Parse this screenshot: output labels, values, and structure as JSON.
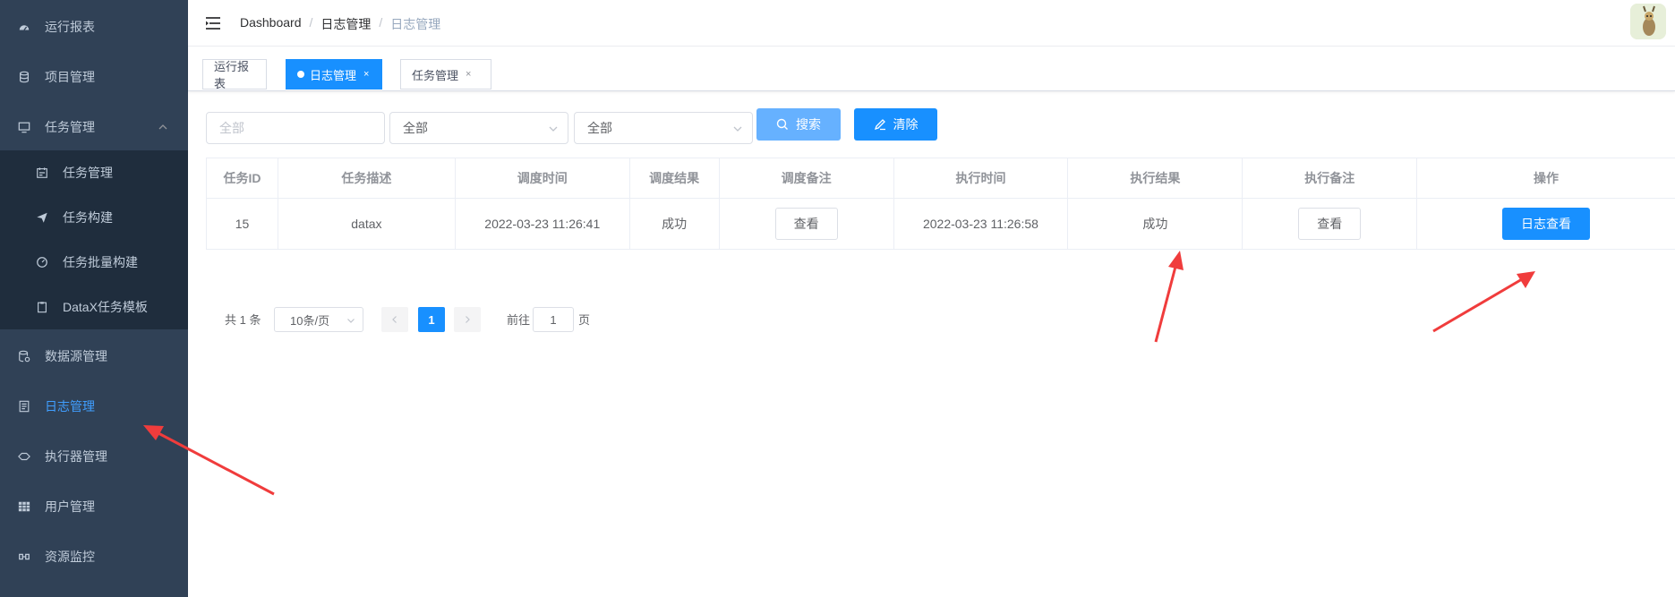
{
  "sidebar": {
    "items": [
      {
        "label": "运行报表",
        "icon": "dashboard-icon"
      },
      {
        "label": "项目管理",
        "icon": "database-icon"
      },
      {
        "label": "任务管理",
        "icon": "monitor-icon"
      },
      {
        "label": "数据源管理",
        "icon": "datasource-icon"
      },
      {
        "label": "日志管理",
        "icon": "document-icon"
      },
      {
        "label": "执行器管理",
        "icon": "executor-icon"
      },
      {
        "label": "用户管理",
        "icon": "grid-icon"
      },
      {
        "label": "资源监控",
        "icon": "infinity-icon"
      }
    ],
    "subitems": [
      {
        "label": "任务管理",
        "icon": "calendar-icon"
      },
      {
        "label": "任务构建",
        "icon": "send-icon"
      },
      {
        "label": "任务批量构建",
        "icon": "gauge-icon"
      },
      {
        "label": "DataX任务模板",
        "icon": "clipboard-icon"
      }
    ],
    "active": "日志管理"
  },
  "navbar": {
    "breadcrumb": [
      "Dashboard",
      "日志管理",
      "日志管理"
    ],
    "separator": "/"
  },
  "tags": [
    {
      "label": "运行报表",
      "active": false,
      "closable": false
    },
    {
      "label": "日志管理",
      "active": true,
      "closable": true
    },
    {
      "label": "任务管理",
      "active": false,
      "closable": true
    }
  ],
  "tag_close": "×",
  "filters": {
    "job_placeholder": "全部",
    "select1_value": "全部",
    "select2_value": "全部",
    "search_label": "搜索",
    "clear_label": "清除"
  },
  "table": {
    "headers": [
      "任务ID",
      "任务描述",
      "调度时间",
      "调度结果",
      "调度备注",
      "执行时间",
      "执行结果",
      "执行备注",
      "操作"
    ],
    "rows": [
      {
        "id": "15",
        "desc": "datax",
        "trigger_time": "2022-03-23 11:26:41",
        "trigger_result": "成功",
        "trigger_note_btn": "查看",
        "handle_time": "2022-03-23 11:26:58",
        "handle_result": "成功",
        "handle_note_btn": "查看",
        "action_btn": "日志查看"
      }
    ]
  },
  "pagination": {
    "total": "共 1 条",
    "page_size": "10条/页",
    "current": "1",
    "goto_label": "前往",
    "goto_value": "1",
    "page_suffix": "页"
  },
  "colors": {
    "sidebar_bg": "#304156",
    "submenu_bg": "#1f2d3d",
    "primary": "#1890ff",
    "active_menu": "#409eff",
    "annotation_arrow": "#f03c3c"
  }
}
